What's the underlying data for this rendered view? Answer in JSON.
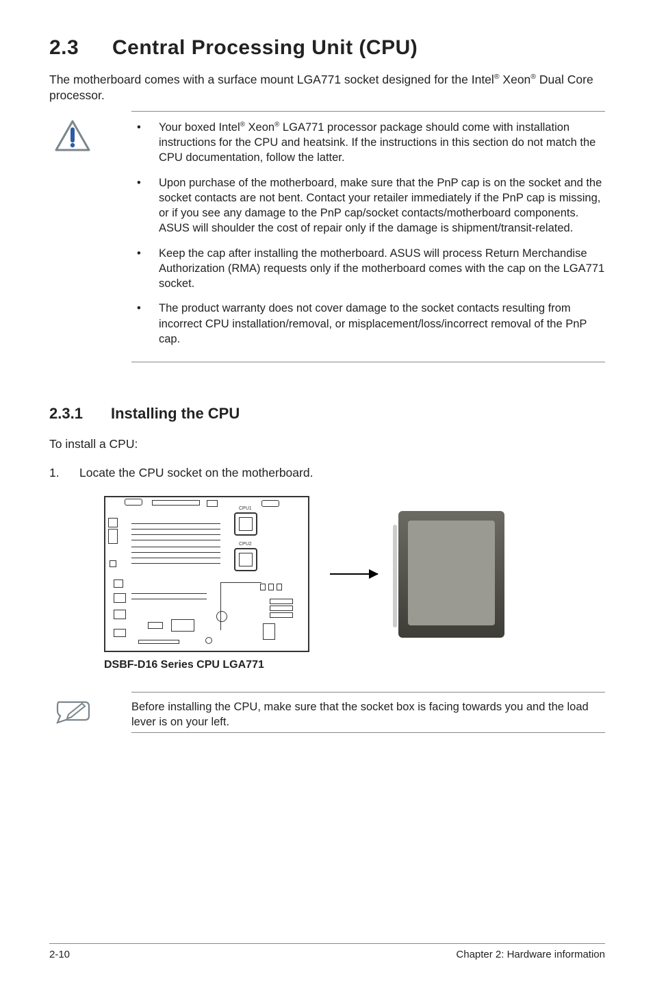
{
  "heading": {
    "number": "2.3",
    "title": "Central Processing Unit (CPU)"
  },
  "intro_parts": {
    "p1": "The motherboard comes with a surface mount LGA771 socket designed for the Intel",
    "p2": " Xeon",
    "p3": " Dual Core processor."
  },
  "caution": {
    "icon_name": "caution-triangle-icon",
    "items": [
      {
        "pre": "Your boxed Intel",
        "mid": " Xeon",
        "post": " LGA771 processor package should come with installation instructions for the CPU and heatsink. If the instructions in this section do not match the CPU documentation, follow the latter."
      },
      {
        "text": "Upon purchase of the motherboard, make sure that the PnP cap is on the socket and the socket contacts are not bent. Contact your retailer immediately if the PnP cap is missing, or if you see any damage to the PnP cap/socket contacts/motherboard components. ASUS will shoulder the cost of repair only if the damage is shipment/transit-related."
      },
      {
        "text": "Keep the cap after installing the motherboard. ASUS will process Return Merchandise Authorization (RMA) requests only if the motherboard comes with the cap on the LGA771 socket."
      },
      {
        "text": "The product warranty does not cover damage to the socket contacts resulting from incorrect CPU installation/removal, or misplacement/loss/incorrect removal of the PnP cap."
      }
    ]
  },
  "subheading": {
    "number": "2.3.1",
    "title": "Installing the CPU"
  },
  "body1": "To install a CPU:",
  "step1": {
    "num": "1.",
    "text": "Locate the CPU socket on the motherboard."
  },
  "diagram": {
    "label_cpu1": "CPU1",
    "label_cpu2": "CPU2",
    "caption": "DSBF-D16 Series CPU LGA771"
  },
  "note2": {
    "icon_name": "note-pencil-icon",
    "text": "Before installing the CPU, make sure that the socket box is facing towards you and the load lever is on your left."
  },
  "footer": {
    "left": "2-10",
    "right": "Chapter 2: Hardware information"
  },
  "reg_mark": "®"
}
